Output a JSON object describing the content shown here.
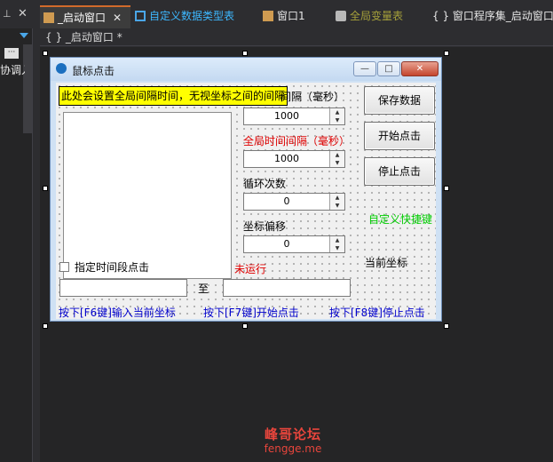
{
  "ide": {
    "tabs": [
      {
        "label": "_启动窗口",
        "active": true
      },
      {
        "label": "自定义数据类型表"
      },
      {
        "label": "窗口1"
      },
      {
        "label": "全局变量表"
      },
      {
        "label": "窗口程序集_启动窗口"
      }
    ],
    "tab_close_glyph": "✕",
    "left_pin_glyph": "⊥",
    "left_close_glyph": "✕",
    "ellipsis_glyph": "···",
    "left_clipped_text": "协调入",
    "subheader_text": "{ } _启动窗口 *",
    "tab_icon_progset": "{ }"
  },
  "form": {
    "title": "鼠标点击",
    "window_buttons": {
      "minimize": "—",
      "maximize": "□",
      "close": "✕"
    },
    "tooltip": "此处会设置全局间隔时间，无视坐标之间的间隔",
    "label_interval": "间隔（毫秒）",
    "interval_value": "1000",
    "label_global_interval": "全局时间间隔（毫秒）",
    "global_interval_value": "1000",
    "label_loop_count": "循环次数",
    "loop_count_value": "0",
    "label_offset": "坐标偏移",
    "offset_value": "0",
    "spin_up": "▲",
    "spin_down": "▼",
    "btn_save": "保存数据",
    "btn_start": "开始点击",
    "btn_stop": "停止点击",
    "label_hotkey": "自定义快捷键",
    "label_current_coord": "当前坐标",
    "checkbox_label": "指定时间段点击",
    "status_text": "未运行",
    "label_to": "至",
    "hint_f6": "按下[F6键]输入当前坐标",
    "hint_f7": "按下[F7键]开始点击",
    "hint_f8": "按下[F8键]停止点击"
  },
  "watermark": {
    "cn": "峰哥论坛",
    "en": "fengge.me"
  },
  "colors": {
    "tab_accent": "#d16a2b",
    "tooltip_bg": "#ffff00",
    "hint": "#0000cc",
    "status_red": "#e00000",
    "hotkey_green": "#00cc00"
  }
}
